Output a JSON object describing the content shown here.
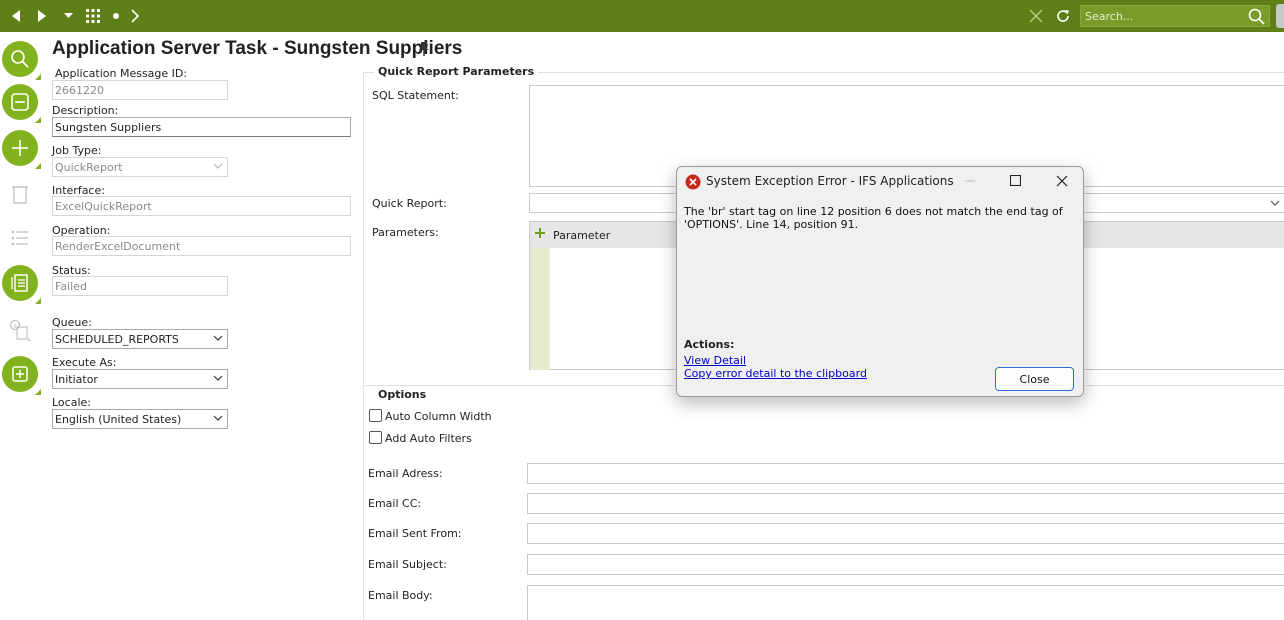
{
  "topbar": {
    "search_placeholder": "Search...",
    "icons": [
      "back-arrow-icon",
      "forward-arrow-icon",
      "dropdown-caret-icon",
      "apps-grid-icon",
      "dot-icon",
      "chevron-right-icon",
      "close-x-icon",
      "refresh-icon",
      "search-icon"
    ],
    "accent": "#5e7f18"
  },
  "rail": {
    "icons": [
      "search-icon",
      "overview-icon",
      "add-icon",
      "trash-icon",
      "list-icon",
      "details-list-icon",
      "info-document-icon",
      "add-document-icon"
    ],
    "accent": "#82b31e"
  },
  "page": {
    "title": "Application Server Task - Sungsten Suppliers"
  },
  "form": {
    "msg_id_label": "Application Message ID:",
    "msg_id_value": "2661220",
    "description_label": "Description:",
    "description_value": "Sungsten Suppliers",
    "job_type_label": "Job Type:",
    "job_type_value": "QuickReport",
    "interface_label": "Interface:",
    "interface_value": "ExcelQuickReport",
    "operation_label": "Operation:",
    "operation_value": "RenderExcelDocument",
    "status_label": "Status:",
    "status_value": "Failed",
    "queue_label": "Queue:",
    "queue_value": "SCHEDULED_REPORTS",
    "execute_as_label": "Execute As:",
    "execute_as_value": "Initiator",
    "locale_label": "Locale:",
    "locale_value": "English (United States)"
  },
  "quick_report": {
    "section_title": "Quick Report Parameters",
    "sql_label": "SQL Statement:",
    "quick_report_label": "Quick Report:",
    "parameters_label": "Parameters:",
    "parameter_column": "Parameter"
  },
  "options": {
    "section_title": "Options",
    "auto_column_width": "Auto Column Width",
    "add_auto_filters": "Add Auto Filters",
    "email_address_label": "Email Adress:",
    "email_cc_label": "Email CC:",
    "email_sent_from_label": "Email Sent From:",
    "email_subject_label": "Email Subject:",
    "email_body_label": "Email Body:"
  },
  "dialog": {
    "title": "System Exception Error - IFS Applications",
    "message": "The 'br' start tag on line 12 position 6 does not match the end tag of 'OPTIONS'. Line 14, position 91.",
    "actions_label": "Actions:",
    "view_detail": "View Detail",
    "copy_detail": "Copy error detail to the clipboard",
    "close_button": "Close",
    "error_color": "#c42b1c"
  }
}
